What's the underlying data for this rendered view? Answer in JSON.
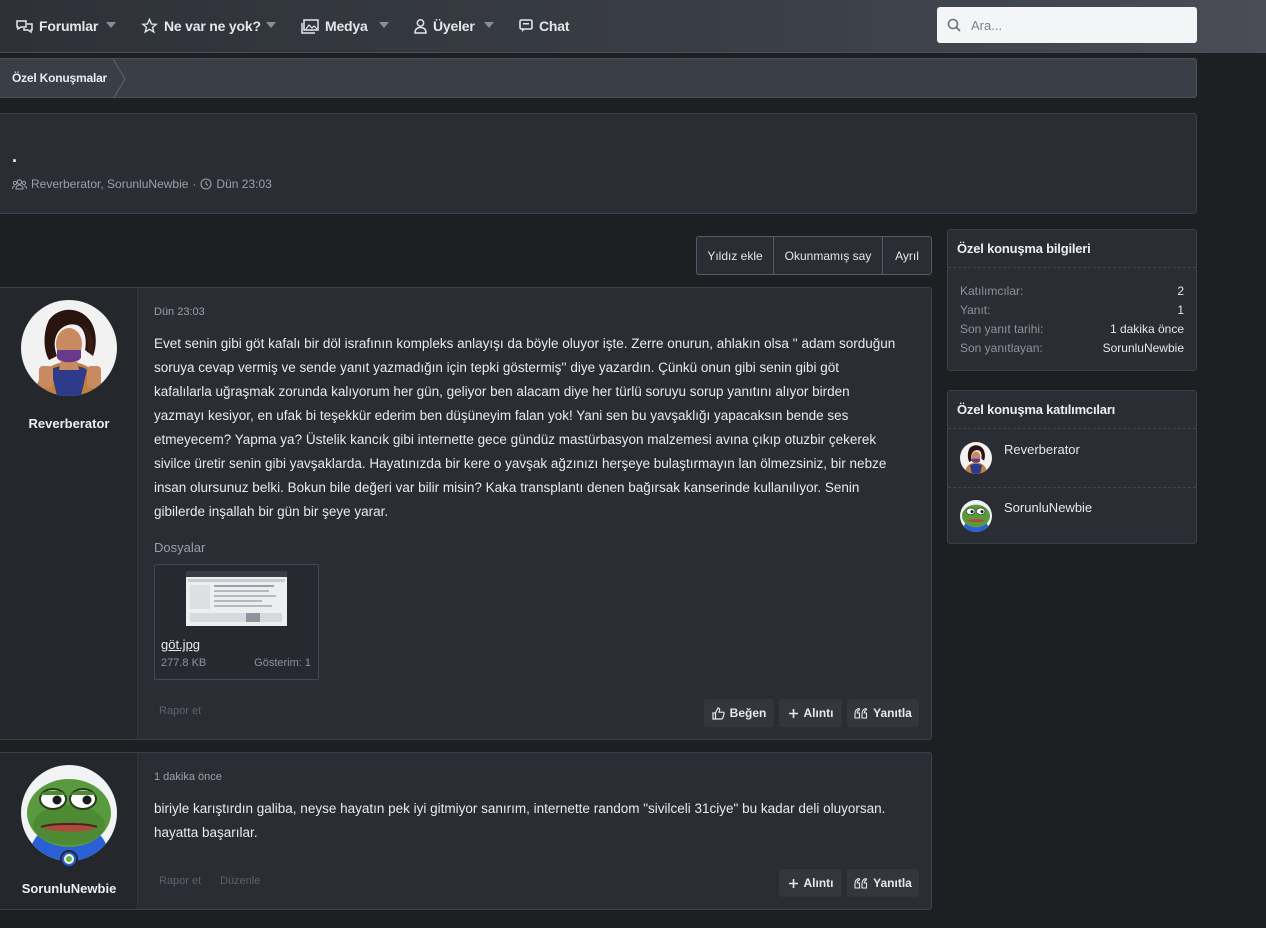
{
  "nav": {
    "items": [
      {
        "label": "Forumlar",
        "icon": "comments-icon",
        "has_caret": true
      },
      {
        "label": "Ne var ne yok?",
        "icon": "star-icon",
        "has_caret": true
      },
      {
        "label": "Medya",
        "icon": "images-icon",
        "has_caret": true
      },
      {
        "label": "Üyeler",
        "icon": "user-icon",
        "has_caret": true
      },
      {
        "label": "Chat",
        "icon": "chat-icon",
        "has_caret": false
      }
    ],
    "search_placeholder": "Ara..."
  },
  "breadcrumb": {
    "label": "Özel Konuşmalar"
  },
  "conversation": {
    "title": ".",
    "participants_text": "Reverberator, SorunluNewbie",
    "separator": "·",
    "date": "Dün 23:03"
  },
  "actions": {
    "star": "Yıldız ekle",
    "unread": "Okunmamış say",
    "leave": "Ayrıl"
  },
  "messages": [
    {
      "user": "Reverberator",
      "date": "Dün 23:03",
      "lines": [
        "Evet senin gibi göt kafalı bir döl israfının kompleks anlayışı da böyle oluyor işte. Zerre onurun, ahlakın olsa '' adam sorduğun",
        "soruya cevap vermiş ve sende yanıt yazmadığın için tepki göstermiş'' diye yazardın. Çünkü onun gibi senin gibi göt",
        "kafalılarla uğraşmak zorunda kalıyorum her gün, geliyor ben alacam diye her türlü soruyu sorup yanıtını alıyor birden",
        "yazmayı kesiyor, en ufak bi teşekkür ederim ben düşüneyim falan yok! Yani sen bu yavşaklığı yapacaksın bende ses",
        "etmeyecem? Yapma ya? Üstelik kancık gibi internette gece gündüz mastürbasyon malzemesi avına çıkıp otuzbir çekerek",
        "sivilce üretir senin gibi yavşaklarda. Hayatınızda bir kere o yavşak ağzınızı herşeye bulaştırmayın lan ölmezsiniz, bir nebze",
        "insan olursunuz belki. Bokun bile değeri var bilir misin? Kaka transplantı denen bağırsak kanserinde kullanılıyor. Senin",
        "gibilerde inşallah bir gün bir şeye yarar."
      ],
      "files_label": "Dosyalar",
      "attachment": {
        "name": "göt.jpg",
        "size": "277.8 KB",
        "views": "Gösterim: 1"
      },
      "report": "Rapor et",
      "buttons": {
        "like": "Beğen",
        "quote": "Alıntı",
        "reply": "Yanıtla"
      }
    },
    {
      "user": "SorunluNewbie",
      "date": "1 dakika önce",
      "lines": [
        "biriyle karıştırdın galiba, neyse hayatın pek iyi gitmiyor sanırım, internette random \"sivilceli 31ciye\" bu kadar deli oluyorsan.",
        "hayatta başarılar."
      ],
      "report": "Rapor et",
      "edit": "Düzenle",
      "buttons": {
        "quote": "Alıntı",
        "reply": "Yanıtla"
      }
    }
  ],
  "sidebar": {
    "info": {
      "title": "Özel konuşma bilgileri",
      "rows": [
        {
          "k": "Katılımcılar:",
          "v": "2"
        },
        {
          "k": "Yanıt:",
          "v": "1"
        },
        {
          "k": "Son yanıt tarihi:",
          "v": "1 dakika önce"
        },
        {
          "k": "Son yanıtlayan:",
          "v": "SorunluNewbie"
        }
      ]
    },
    "participants": {
      "title": "Özel konuşma katılımcıları",
      "list": [
        "Reverberator",
        "SorunluNewbie"
      ]
    }
  },
  "colors": {
    "background": "#1d1f23",
    "panel": "#2a2d33",
    "nav": "#3a3e46"
  }
}
